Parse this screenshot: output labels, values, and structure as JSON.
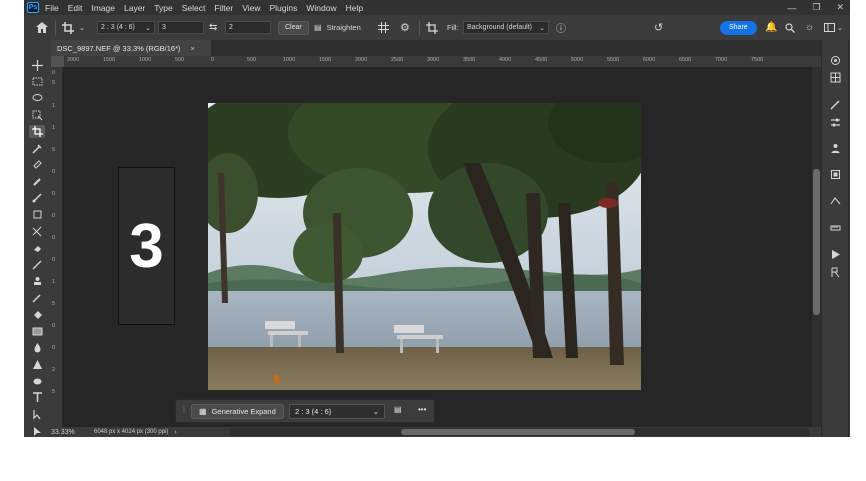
{
  "menu": [
    "File",
    "Edit",
    "Image",
    "Layer",
    "Type",
    "Select",
    "Filter",
    "View",
    "Plugins",
    "Window",
    "Help"
  ],
  "app_logo": "Ps",
  "options": {
    "ratio_preset": "2 : 3 (4 : 6)",
    "ratio_w": "3",
    "ratio_h": "2",
    "clear_label": "Clear",
    "straighten_label": "Straighten",
    "fill_label": "Fill:",
    "fill_value": "Background (default)",
    "share_label": "Share"
  },
  "document": {
    "tab_title": "DSC_9897.NEF @ 33.3% (RGB/16*)",
    "close": "×"
  },
  "ruler_top": [
    "2000",
    "1500",
    "1000",
    "500",
    "0",
    "500",
    "1000",
    "1500",
    "2000",
    "2500",
    "3000",
    "3500",
    "4000",
    "4500",
    "5000",
    "5500",
    "6000",
    "6500",
    "7000",
    "7500"
  ],
  "ruler_left": [
    "0",
    "5",
    "1",
    "1",
    "5",
    "0",
    "0",
    "0",
    "0",
    "0",
    "1",
    "5",
    "0",
    "0",
    "2",
    "5"
  ],
  "overlay_number": "3",
  "contextual_bar": {
    "gen_expand_label": "Generative Expand",
    "ratio_select": "2 : 3 (4 : 6)",
    "more": "•••"
  },
  "status": {
    "zoom": "33.33%",
    "doc_size": "6048 px x 4024 px (300 ppi)"
  },
  "colors": {
    "share": "#1473e6",
    "app_bg": "#535353",
    "canvas_bg": "#262626"
  }
}
